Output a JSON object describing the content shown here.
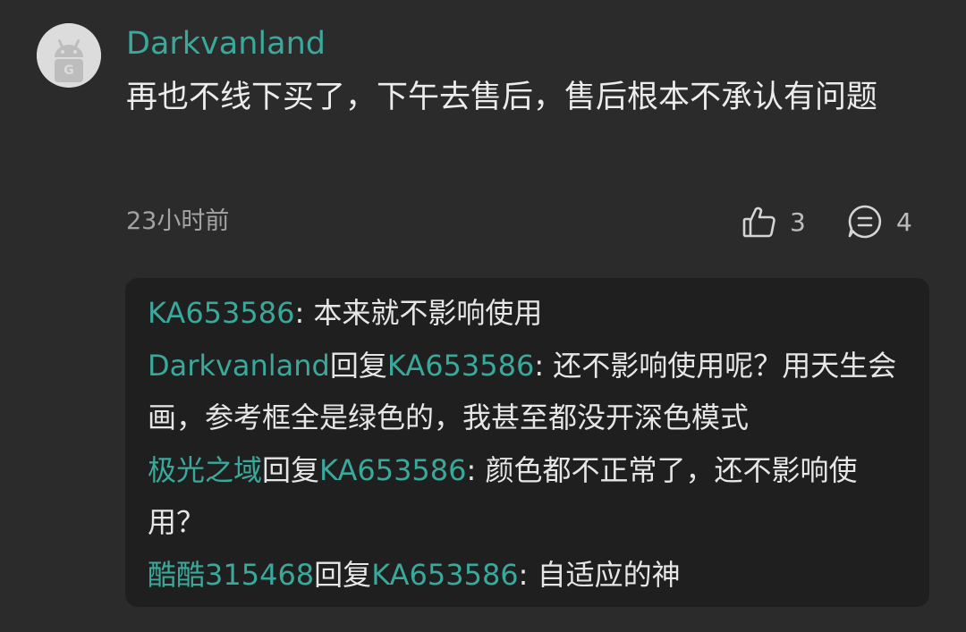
{
  "comment": {
    "username": "Darkvanland",
    "text": "再也不线下买了，下午去售后，售后根本不承认有问题",
    "timestamp": "23小时前",
    "likes": "3",
    "replies_count": "4"
  },
  "replies": [
    {
      "author": "KA653586",
      "reply_word": "",
      "target": "",
      "sep": ": ",
      "text": "本来就不影响使用"
    },
    {
      "author": "Darkvanland",
      "reply_word": "回复",
      "target": "KA653586",
      "sep": ": ",
      "text": "还不影响使用呢？用天生会画，参考框全是绿色的，我甚至都没开深色模式"
    },
    {
      "author": "极光之域",
      "reply_word": "回复",
      "target": "KA653586",
      "sep": ": ",
      "text": "颜色都不正常了，还不影响使用？"
    },
    {
      "author": "酷酷315468",
      "reply_word": "回复",
      "target": "KA653586",
      "sep": ": ",
      "text": "自适应的神"
    }
  ],
  "colors": {
    "background": "#2b2b2b",
    "reply_panel": "#1f1f1f",
    "accent": "#3aa89a",
    "text": "#e9e9e9",
    "muted": "#a3a3a3"
  },
  "icons": [
    "android-avatar-icon",
    "thumbs-up-icon",
    "comment-bubble-icon"
  ]
}
